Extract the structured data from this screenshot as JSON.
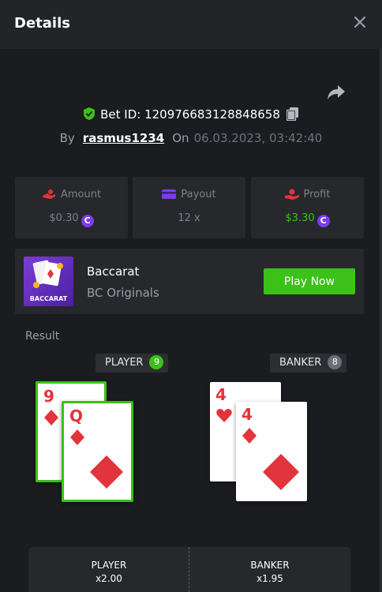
{
  "header": {
    "title": "Details"
  },
  "bet": {
    "id_label": "Bet ID: 120976683128848658",
    "by_label": "By",
    "username": "rasmus1234",
    "on_label": "On",
    "date": "06.03.2023, 03:42:40"
  },
  "stats": {
    "amount": {
      "label": "Amount",
      "value": "$0.30",
      "icon": "chip-hand-icon"
    },
    "payout": {
      "label": "Payout",
      "value": "12 x",
      "icon": "card-icon"
    },
    "profit": {
      "label": "Profit",
      "value": "$3.30",
      "icon": "hand-coin-icon"
    }
  },
  "coin_symbol": "C",
  "game": {
    "name": "Baccarat",
    "provider": "BC Originals",
    "thumb_label": "BACCARAT",
    "play_label": "Play Now"
  },
  "result": {
    "label": "Result",
    "player": {
      "label": "PLAYER",
      "score": "9",
      "cards": [
        "9",
        "Q"
      ]
    },
    "banker": {
      "label": "BANKER",
      "score": "8",
      "cards": [
        "4",
        "4"
      ]
    }
  },
  "payouts": {
    "player": {
      "name": "PLAYER",
      "multiplier": "x2.00"
    },
    "banker": {
      "name": "BANKER",
      "multiplier": "x1.95"
    }
  },
  "colors": {
    "accent_green": "#3bc117",
    "red": "#e2343c",
    "coin": "#7a3cf0",
    "background": "#1a1c1f",
    "panel": "#26282c"
  }
}
